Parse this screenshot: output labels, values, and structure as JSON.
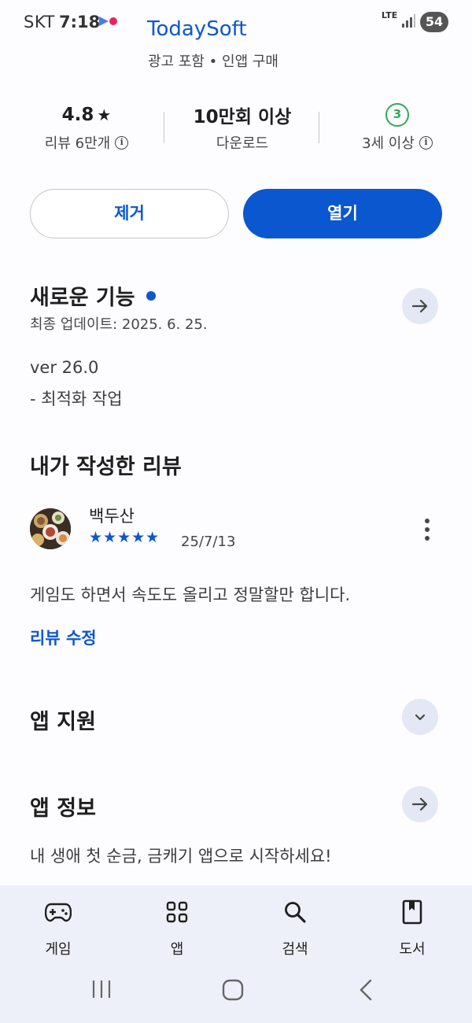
{
  "status_bar": {
    "carrier": "SKT",
    "time": "7:18",
    "network": "LTE",
    "battery": "54"
  },
  "app": {
    "name": "TodaySoft",
    "meta": "광고 포함 • 인앱 구매"
  },
  "stats": {
    "rating": "4.8",
    "rating_star": "★",
    "reviews_label": "리뷰 6만개",
    "downloads": "10만회 이상",
    "downloads_label": "다운로드",
    "age_badge": "3",
    "age_label": "3세 이상",
    "info_glyph": "i"
  },
  "actions": {
    "uninstall": "제거",
    "open": "열기"
  },
  "whats_new": {
    "title": "새로운 기능",
    "updated": "최종 업데이트: 2025. 6. 25.",
    "version": "ver 26.0",
    "notes": "- 최적화 작업"
  },
  "my_review": {
    "title": "내가 작성한 리뷰",
    "author": "백두산",
    "stars": "★★★★★",
    "rating_value": 5,
    "date": "25/7/13",
    "text": "게임도 하면서 속도도 올리고 정말할만 합니다.",
    "edit_link": "리뷰 수정"
  },
  "app_support": {
    "title": "앱 지원"
  },
  "app_info": {
    "title": "앱 정보",
    "description": "내 생애 첫 순금, 금캐기 앱으로 시작하세요!"
  },
  "bottom_nav": {
    "games": "게임",
    "apps": "앱",
    "search": "검색",
    "books": "도서"
  },
  "colors": {
    "accent": "#0b57d0",
    "age_badge": "#34a853",
    "nav_background": "#eef0f9"
  }
}
